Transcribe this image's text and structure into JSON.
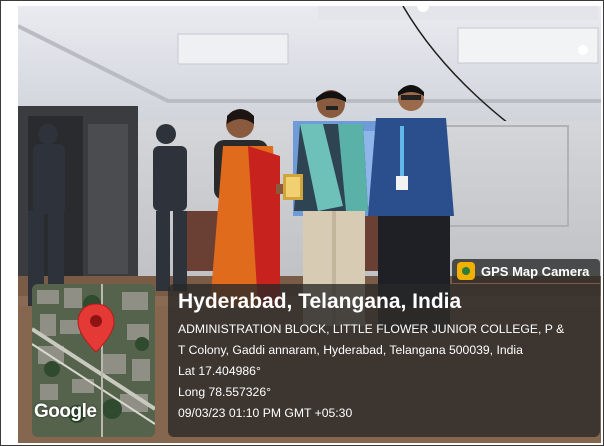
{
  "badge": {
    "label": "GPS Map Camera",
    "icon": "camera-app-icon"
  },
  "location": {
    "title": "Hyderabad, Telangana, India",
    "address_line1": "ADMINISTRATION BLOCK, LITTLE FLOWER JUNIOR COLLEGE, P &",
    "address_line2": "T Colony, Gaddi annaram, Hyderabad, Telangana 500039, India",
    "lat": "Lat 17.404986°",
    "long": "Long 78.557326°",
    "timestamp": "09/03/23 01:10 PM GMT +05:30"
  },
  "map": {
    "brand": "Google",
    "pin_icon": "map-pin-icon",
    "pin_color": "#e53935"
  }
}
